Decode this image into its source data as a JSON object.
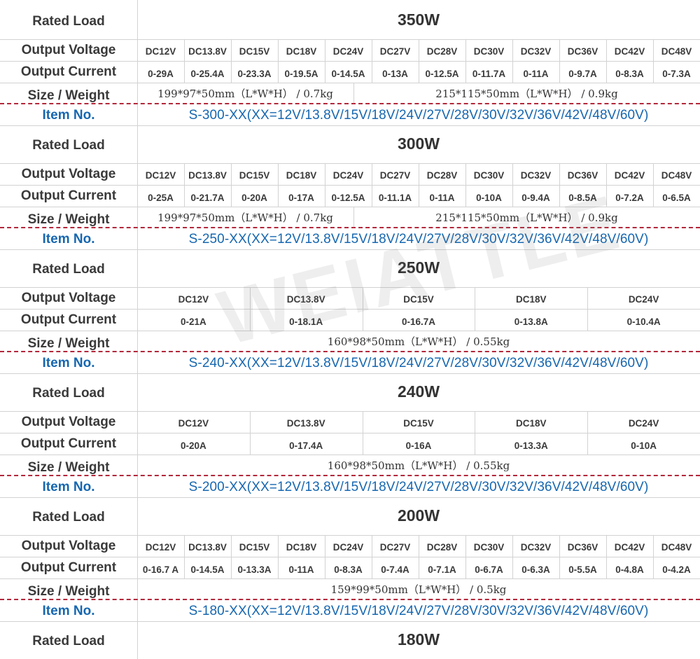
{
  "labels": {
    "rated_load": "Rated Load",
    "output_voltage": "Output Voltage",
    "output_current": "Output Current",
    "size_weight": "Size / Weight",
    "item_no": "Item No."
  },
  "watermark": "WEIATTLE",
  "colors": {
    "item_blue": "#1667b0",
    "dash_red": "#b2283b",
    "grid": "#d2d2d2"
  },
  "blocks": [
    {
      "load": "350W",
      "voltages": [
        "DC12V",
        "DC13.8V",
        "DC15V",
        "DC18V",
        "DC24V",
        "DC27V",
        "DC28V",
        "DC30V",
        "DC32V",
        "DC36V",
        "DC42V",
        "DC48V"
      ],
      "currents": [
        "0-29A",
        "0-25.4A",
        "0-23.3A",
        "0-19.5A",
        "0-14.5A",
        "0-13A",
        "0-12.5A",
        "0-11.7A",
        "0-11A",
        "0-9.7A",
        "0-8.3A",
        "0-7.3A"
      ],
      "sizes": [
        "199*97*50mm（L*W*H） / 0.7kg",
        "215*115*50mm（L*W*H） / 0.9kg"
      ],
      "item": "S-300-XX(XX=12V/13.8V/15V/18V/24V/27V/28V/30V/32V/36V/42V/48V/60V)"
    },
    {
      "load": "300W",
      "voltages": [
        "DC12V",
        "DC13.8V",
        "DC15V",
        "DC18V",
        "DC24V",
        "DC27V",
        "DC28V",
        "DC30V",
        "DC32V",
        "DC36V",
        "DC42V",
        "DC48V"
      ],
      "currents": [
        "0-25A",
        "0-21.7A",
        "0-20A",
        "0-17A",
        "0-12.5A",
        "0-11.1A",
        "0-11A",
        "0-10A",
        "0-9.4A",
        "0-8.5A",
        "0-7.2A",
        "0-6.5A"
      ],
      "sizes": [
        "199*97*50mm（L*W*H） / 0.7kg",
        "215*115*50mm（L*W*H） / 0.9kg"
      ],
      "item": "S-250-XX(XX=12V/13.8V/15V/18V/24V/27V/28V/30V/32V/36V/42V/48V/60V)"
    },
    {
      "load": "250W",
      "voltages": [
        "DC12V",
        "DC13.8V",
        "DC15V",
        "DC18V",
        "DC24V"
      ],
      "currents": [
        "0-21A",
        "0-18.1A",
        "0-16.7A",
        "0-13.8A",
        "0-10.4A"
      ],
      "sizes": [
        "160*98*50mm（L*W*H） / 0.55kg"
      ],
      "item": "S-240-XX(XX=12V/13.8V/15V/18V/24V/27V/28V/30V/32V/36V/42V/48V/60V)"
    },
    {
      "load": "240W",
      "voltages": [
        "DC12V",
        "DC13.8V",
        "DC15V",
        "DC18V",
        "DC24V"
      ],
      "currents": [
        "0-20A",
        "0-17.4A",
        "0-16A",
        "0-13.3A",
        "0-10A"
      ],
      "sizes": [
        "160*98*50mm（L*W*H） / 0.55kg"
      ],
      "item": "S-200-XX(XX=12V/13.8V/15V/18V/24V/27V/28V/30V/32V/36V/42V/48V/60V)"
    },
    {
      "load": "200W",
      "voltages": [
        "DC12V",
        "DC13.8V",
        "DC15V",
        "DC18V",
        "DC24V",
        "DC27V",
        "DC28V",
        "DC30V",
        "DC32V",
        "DC36V",
        "DC42V",
        "DC48V"
      ],
      "currents": [
        "0-16.7 A",
        "0-14.5A",
        "0-13.3A",
        "0-11A",
        "0-8.3A",
        "0-7.4A",
        "0-7.1A",
        "0-6.7A",
        "0-6.3A",
        "0-5.5A",
        "0-4.8A",
        "0-4.2A"
      ],
      "sizes": [
        "159*99*50mm（L*W*H） / 0.5kg"
      ],
      "item": "S-180-XX(XX=12V/13.8V/15V/18V/24V/27V/28V/30V/32V/36V/42V/48V/60V)"
    },
    {
      "load": "180W",
      "voltages": [],
      "currents": [],
      "sizes": [],
      "item": ""
    }
  ]
}
